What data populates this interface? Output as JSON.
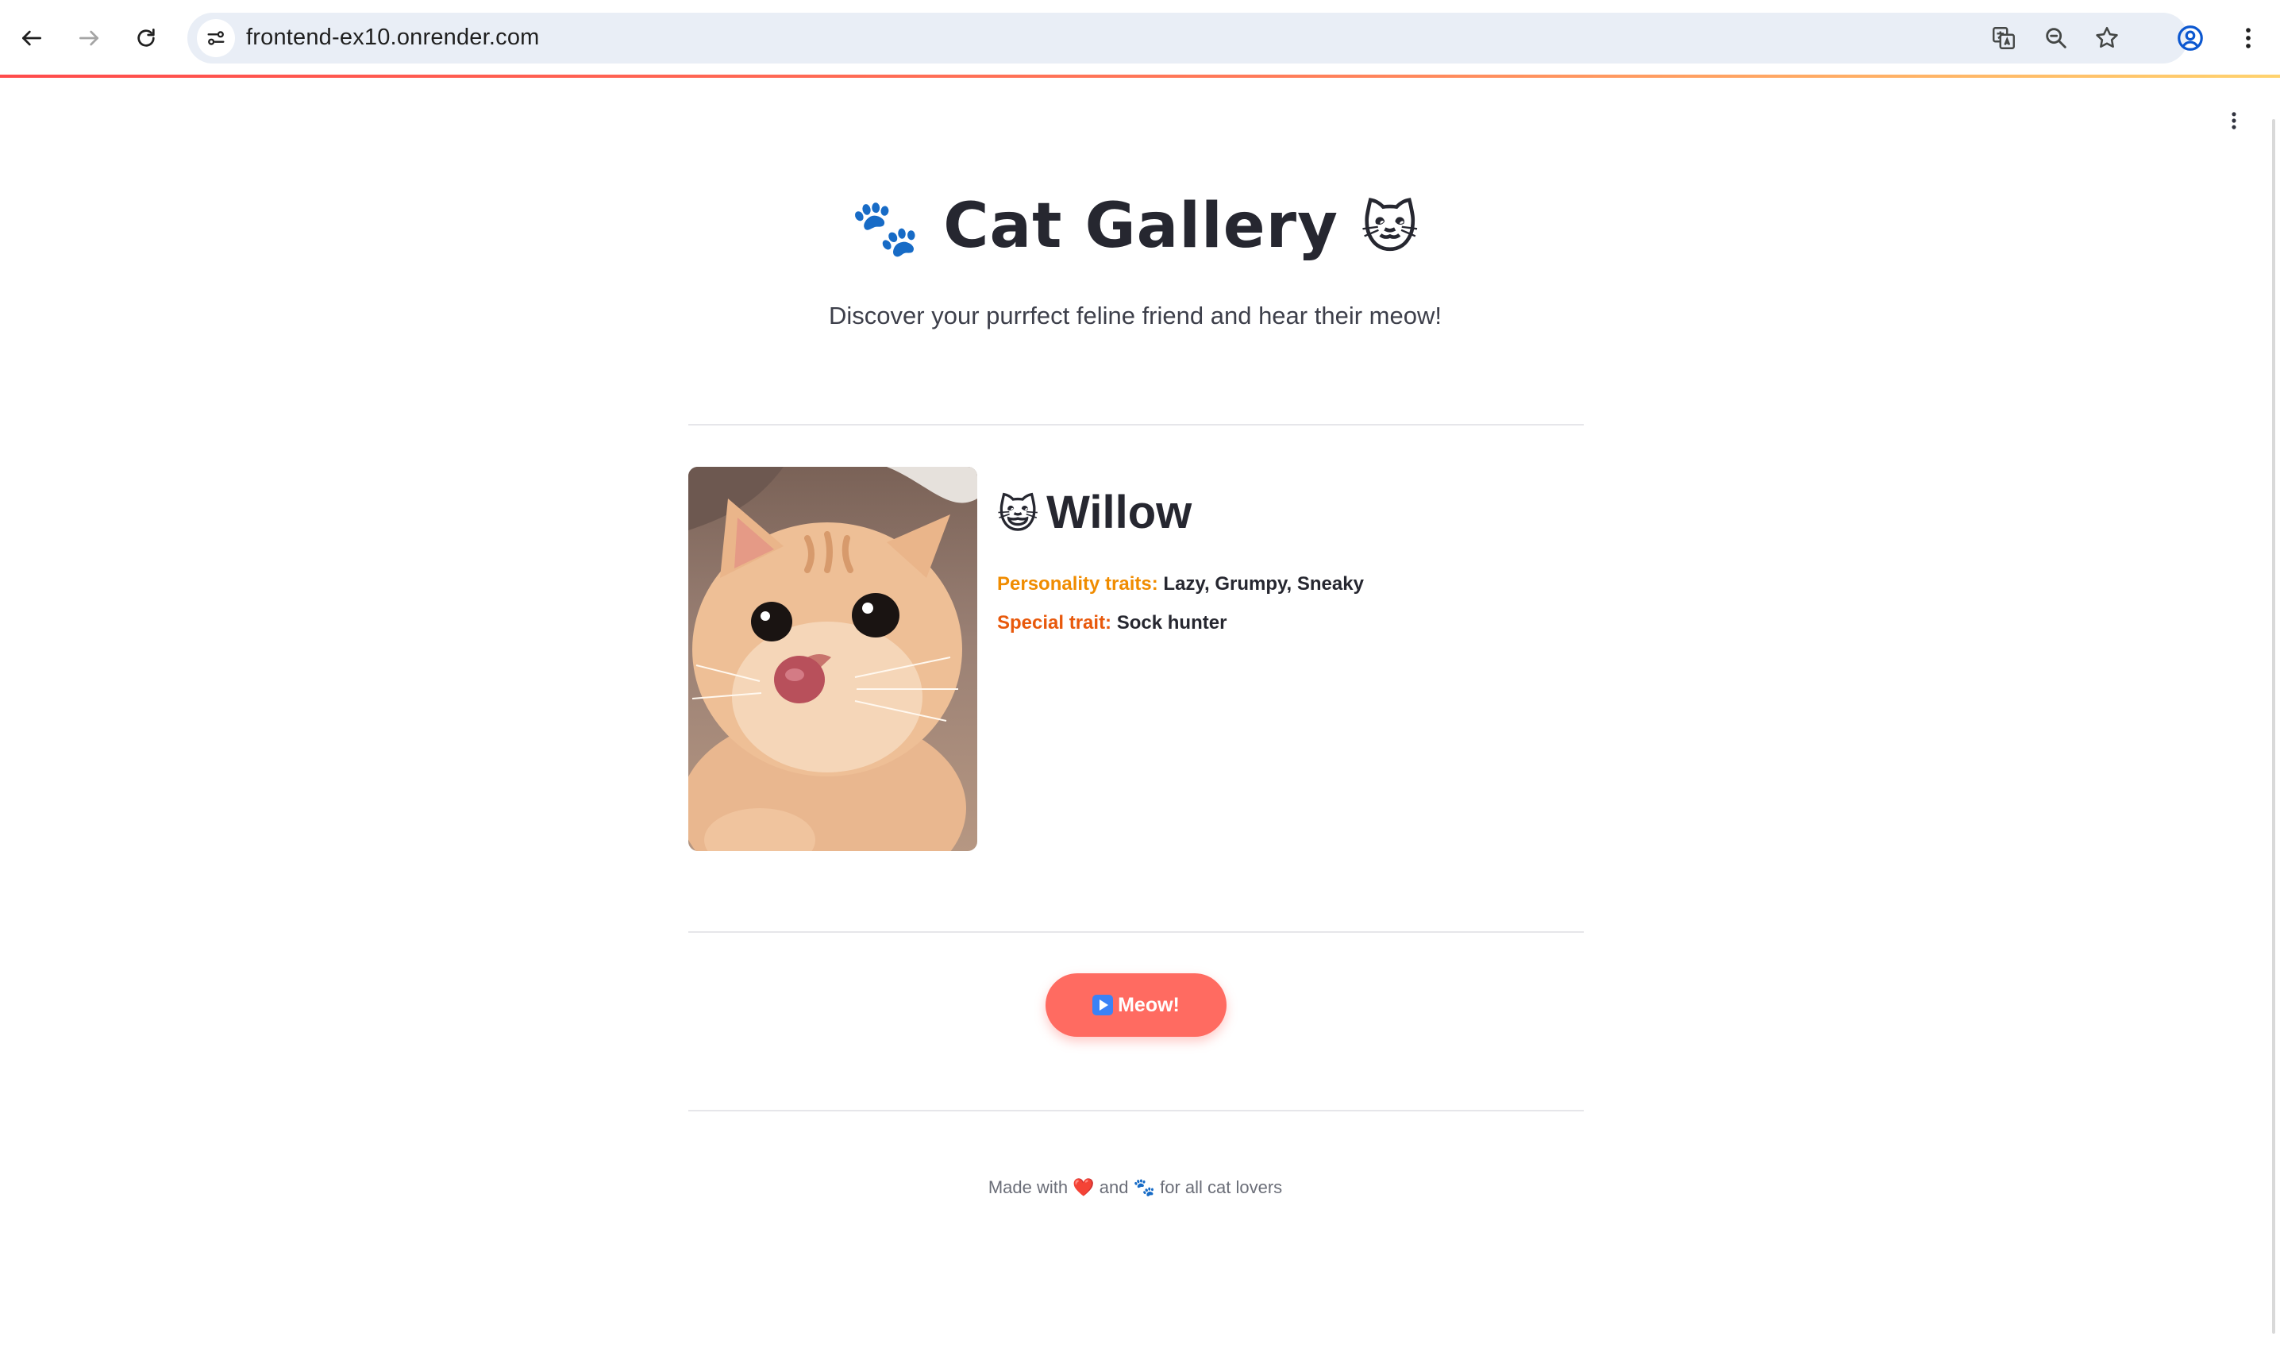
{
  "browser": {
    "url": "frontend-ex10.onrender.com"
  },
  "page": {
    "title_text": "Cat Gallery",
    "title_emoji_left": "🐾",
    "title_emoji_right": "🐱",
    "subtitle": "Discover your purrfect feline friend and hear their meow!"
  },
  "cat": {
    "name_emoji": "😺",
    "name": "Willow",
    "personality_label": "Personality traits:",
    "personality_value": "Lazy, Grumpy, Sneaky",
    "special_label": "Special trait:",
    "special_value": "Sock hunter"
  },
  "actions": {
    "meow_label": "Meow!"
  },
  "footer": {
    "prefix": "Made with",
    "heart": "❤️",
    "middle": "and",
    "paw": "🐾",
    "suffix": "for all cat lovers"
  },
  "colors": {
    "accent": "#ff6b61",
    "trait_label": "#f08c00",
    "special_label": "#e8590c",
    "progress_start": "#ff4b4b",
    "progress_end": "#ffd36e"
  },
  "icons": {
    "browser": [
      "back-arrow-icon",
      "forward-arrow-icon",
      "reload-icon",
      "site-settings-icon",
      "translate-icon",
      "zoom-icon",
      "bookmark-star-icon",
      "profile-icon",
      "kebab-menu-icon"
    ],
    "page": [
      "kebab-menu-icon",
      "play-icon"
    ]
  }
}
